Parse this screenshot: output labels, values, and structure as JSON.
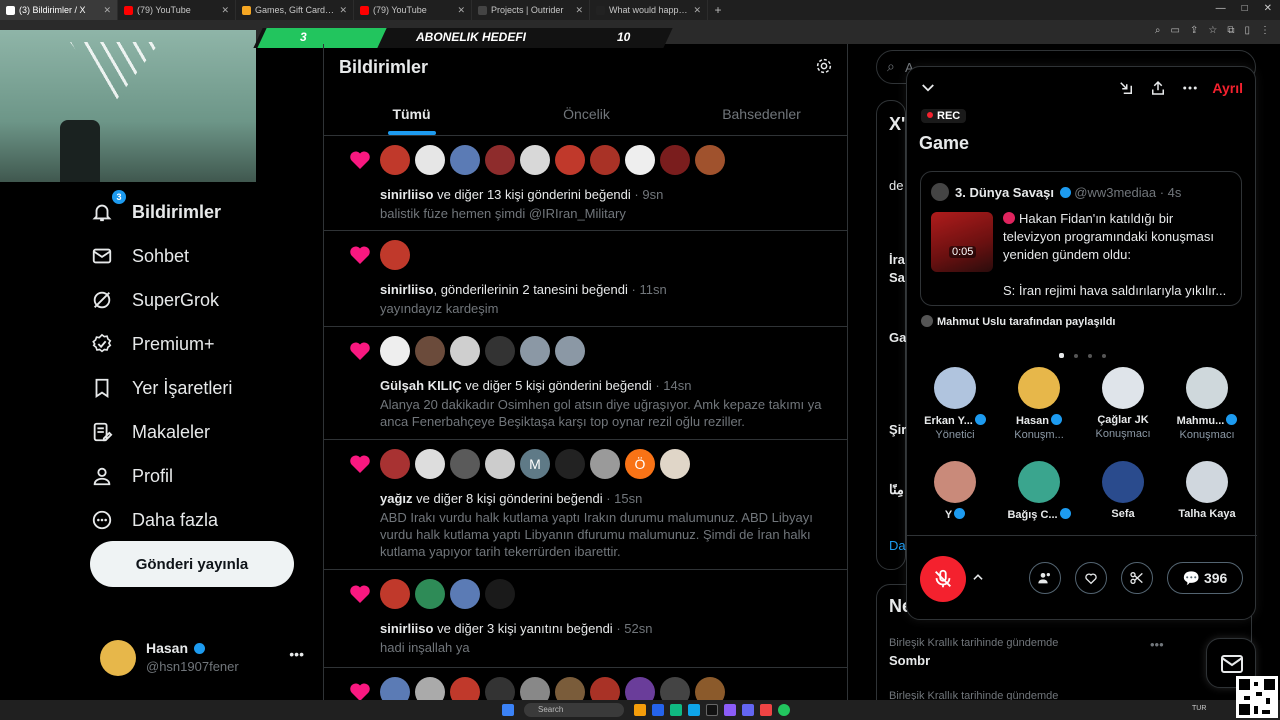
{
  "browser": {
    "tabs": [
      {
        "label": "(3) Bildirimler / X",
        "active": true,
        "favicon_color": "#ffffff"
      },
      {
        "label": "(79) YouTube",
        "active": false,
        "favicon_color": "#ff0000"
      },
      {
        "label": "Games, Gift Cards, Top-Ups & Mo",
        "active": false,
        "favicon_color": "#f5a623"
      },
      {
        "label": "(79) YouTube",
        "active": false,
        "favicon_color": "#ff0000"
      },
      {
        "label": "Projects | Outrider",
        "active": false,
        "favicon_color": "#444444"
      },
      {
        "label": "What would happen if a nuclea",
        "active": false,
        "favicon_color": "#222222"
      }
    ]
  },
  "banner": {
    "left_value": "3",
    "title": "ABONELIK HEDEFI",
    "right_value": "10"
  },
  "nav": {
    "items": [
      {
        "label": "Bildirimler",
        "icon": "bell-icon",
        "badge": "3",
        "active": true
      },
      {
        "label": "Sohbet",
        "icon": "mail-icon"
      },
      {
        "label": "SuperGrok",
        "icon": "grok-icon"
      },
      {
        "label": "Premium+",
        "icon": "verified-icon"
      },
      {
        "label": "Yer İşaretleri",
        "icon": "bookmark-icon"
      },
      {
        "label": "Makaleler",
        "icon": "article-icon"
      },
      {
        "label": "Profil",
        "icon": "person-icon"
      },
      {
        "label": "Daha fazla",
        "icon": "more-circle-icon"
      }
    ],
    "post_button": "Gönderi yayınla",
    "profile": {
      "name": "Hasan",
      "handle": "@hsn1907fener"
    }
  },
  "main": {
    "title": "Bildirimler",
    "tabs": [
      "Tümü",
      "Öncelik",
      "Bahsedenler"
    ],
    "notifications": [
      {
        "user": "sinirliiso",
        "action": " ve diğer 13 kişi gönderini beğendi",
        "time": "9sn",
        "text": "balistik füze hemen şimdi @IRIran_Military",
        "avatars": [
          "#c0392b",
          "#e6e6e6",
          "#5b7bb5",
          "#8e2c2c",
          "#d8d8d8",
          "#c0392b",
          "#a93226",
          "#eeeeee",
          "#7a1d1d",
          "#a0522d"
        ]
      },
      {
        "user": "sinirliiso",
        "action": ", gönderilerinin 2 tanesini beğendi",
        "time": "11sn",
        "text": "yayındayız kardeşim",
        "avatars": [
          "#c0392b"
        ]
      },
      {
        "user": "Gülşah KILIÇ",
        "action": " ve diğer 5 kişi gönderini beğendi",
        "time": "14sn",
        "text": "Alanya 20 dakikadır Osimhen gol atsın diye uğraşıyor. Amk kepaze takımı ya anca Fenerbahçeye Beşiktaşa karşı top oynar rezil oğlu reziller.",
        "avatars": [
          "#eeeeee",
          "#6b4b3b",
          "#cfcfcf",
          "#333333",
          "#8b98a5",
          "#8b98a5"
        ]
      },
      {
        "user": "yağız",
        "action": " ve diğer 8 kişi gönderini beğendi",
        "time": "15sn",
        "text": "ABD Irakı vurdu halk kutlama yaptı Irakın durumu malumunuz. ABD Libyayı vurdu halk kutlama yaptı Libyanın dfurumu malumunuz. Şimdi de İran halkı kutlama yapıyor tarih tekerrürden ibarettir.",
        "avatars": [
          "#a83232",
          "#dddddd",
          "#5a5a5a",
          "#cccccc",
          "#5f7a87",
          "#222222",
          "#9a9a9a",
          "#f97316",
          "#e0d6c8"
        ],
        "letters": {
          "4": "M",
          "7": "Ö"
        }
      },
      {
        "user": "sinirliiso",
        "action": " ve diğer 3 kişi yanıtını beğendi",
        "time": "52sn",
        "text": "hadi inşallah ya",
        "avatars": [
          "#c0392b",
          "#2e8b57",
          "#5b7bb5",
          "#1a1a1a"
        ]
      },
      {
        "user": "",
        "action": "",
        "time": "",
        "text": "",
        "avatars": [
          "#5b7bb5",
          "#aaaaaa",
          "#c0392b",
          "#333333",
          "#888888",
          "#7a5c3a",
          "#a93226",
          "#6a3d9a",
          "#444444",
          "#8b5a2b"
        ]
      }
    ]
  },
  "right": {
    "search_placeholder": "A",
    "partial_texts": [
      "X'",
      "de",
      "İra",
      "Sa",
      "Ga",
      "Şir",
      "مِنًا",
      "Da",
      "Ne"
    ],
    "trends": [
      {
        "context": "Birleşik Krallık tarihinde gündemde",
        "name": "Sombr"
      },
      {
        "context": "Birleşik Krallık tarihinde gündemde",
        "name": ""
      }
    ]
  },
  "space": {
    "leave_label": "Ayrıl",
    "rec_label": "REC",
    "title": "Game",
    "tweet": {
      "author": "3. Dünya Savaşı",
      "handle": "@ww3mediaa",
      "time": "4s",
      "duration": "0:05",
      "text": "Hakan Fidan'ın katıldığı bir televizyon programındaki konuşması yeniden gündem oldu:",
      "last_line": "S: İran rejimi hava saldırılarıyla yıkılır..."
    },
    "shared_by": "Mahmut Uslu tarafından paylaşıldı",
    "speakers": [
      {
        "name": "Erkan Y...",
        "role": "Yönetici",
        "verified": true,
        "color": "#b0c4de"
      },
      {
        "name": "Hasan",
        "role": "Konuşm...",
        "verified": true,
        "color": "#e7b74a"
      },
      {
        "name": "Çağlar JK",
        "role": "Konuşmacı",
        "verified": false,
        "color": "#dfe4ea"
      },
      {
        "name": "Mahmu...",
        "role": "Konuşmacı",
        "verified": true,
        "color": "#cfd8dc"
      },
      {
        "name": "Y",
        "role": "",
        "verified": true,
        "color": "#c98a7a"
      },
      {
        "name": "Bağış C...",
        "role": "",
        "verified": true,
        "color": "#3aa58e"
      },
      {
        "name": "Sefa",
        "role": "",
        "verified": false,
        "color": "#2a4b8d"
      },
      {
        "name": "Talha Kaya",
        "role": "",
        "verified": false,
        "color": "#d0d7de"
      }
    ],
    "listener_count": "396"
  },
  "taskbar": {
    "search_label": "Search",
    "lang": "TUR"
  }
}
